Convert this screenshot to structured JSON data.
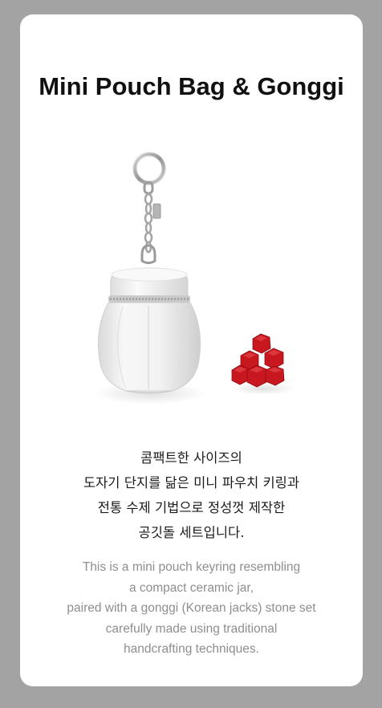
{
  "page": {
    "title": "Mini Pouch Bag & Gonggi",
    "background_color": "#a3a3a3",
    "card_color": "#ffffff"
  },
  "product_image": {
    "items": [
      "keyring-pouch",
      "gonggi-stones"
    ],
    "pouch_color": "#f1f1f1",
    "stone_color": "#c8171e"
  },
  "description_ko": {
    "lines": [
      "콤팩트한 사이즈의",
      "도자기 단지를 닮은 미니 파우치 키링과",
      "전통 수제 기법으로 정성껏 제작한",
      "공깃돌 세트입니다."
    ]
  },
  "description_en": {
    "lines": [
      "This is a mini pouch keyring resembling",
      "a compact ceramic jar,",
      "paired with a gonggi (Korean jacks) stone set",
      "carefully made using traditional",
      "handcrafting techniques."
    ]
  }
}
